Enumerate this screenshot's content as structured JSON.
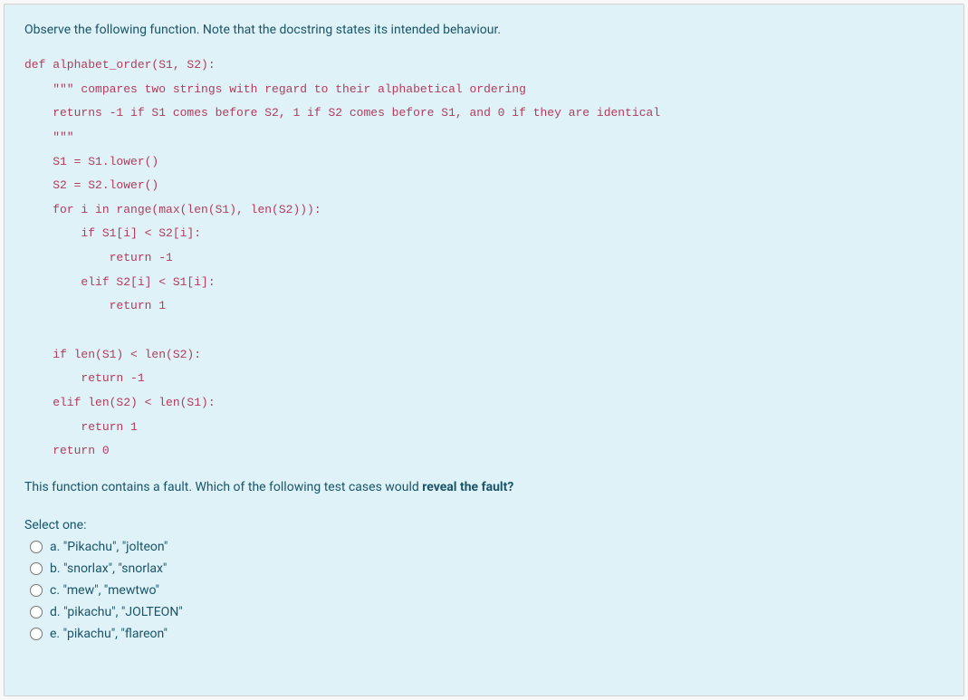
{
  "intro": "Observe the following function.  Note that the docstring states its intended behaviour.",
  "code": "def alphabet_order(S1, S2):\n    \"\"\" compares two strings with regard to their alphabetical ordering\n    returns -1 if S1 comes before S2, 1 if S2 comes before S1, and 0 if they are identical\n    \"\"\"\n    S1 = S1.lower()\n    S2 = S2.lower()\n    for i in range(max(len(S1), len(S2))):\n        if S1[i] < S2[i]:\n            return -1\n        elif S2[i] < S1[i]:\n            return 1\n\n    if len(S1) < len(S2):\n        return -1\n    elif len(S2) < len(S1):\n        return 1\n    return 0",
  "question_prefix": "This function contains a fault.  Which of the following test cases would ",
  "question_bold": "reveal the fault?",
  "select_label": "Select one:",
  "options": [
    {
      "letter": "a.",
      "text": "\"Pikachu\", \"jolteon\""
    },
    {
      "letter": "b.",
      "text": "\"snorlax\", \"snorlax\""
    },
    {
      "letter": "c.",
      "text": "\"mew\", \"mewtwo\""
    },
    {
      "letter": "d.",
      "text": "\"pikachu\", \"JOLTEON\""
    },
    {
      "letter": "e.",
      "text": "\"pikachu\", \"flareon\""
    }
  ]
}
